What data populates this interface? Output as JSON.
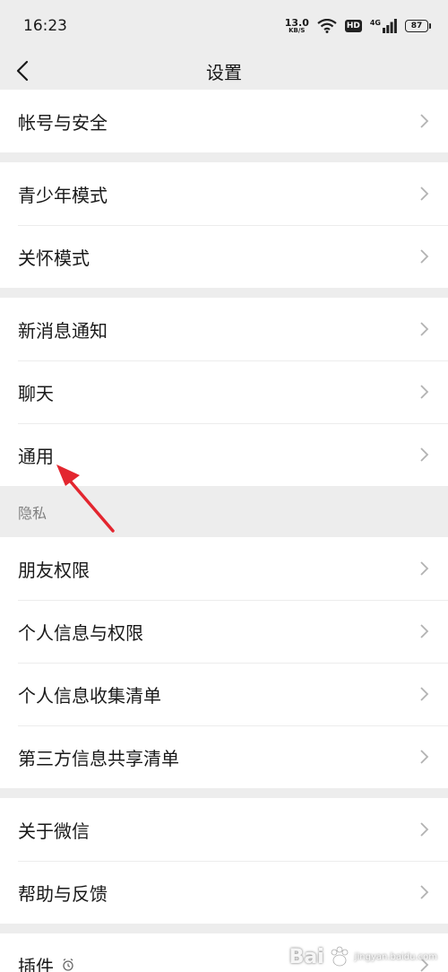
{
  "status": {
    "time": "16:23",
    "net_speed_value": "13.0",
    "net_speed_unit": "KB/S",
    "hd_label": "HD",
    "network_label": "4G",
    "battery_level": "87"
  },
  "nav": {
    "title": "设置",
    "back_icon": "chevron-left-icon"
  },
  "groups": {
    "g1": [
      "帐号与安全"
    ],
    "g2": [
      "青少年模式",
      "关怀模式"
    ],
    "g3": [
      "新消息通知",
      "聊天",
      "通用"
    ],
    "privacy_header": "隐私",
    "g4": [
      "朋友权限",
      "个人信息与权限",
      "个人信息收集清单",
      "第三方信息共享清单"
    ],
    "g5": [
      "关于微信",
      "帮助与反馈"
    ],
    "g6": [
      "插件"
    ]
  },
  "annotation": {
    "arrow_color": "#e3262f"
  },
  "watermark": {
    "text": "Bai",
    "sub": "jingyan.baidu.com"
  }
}
